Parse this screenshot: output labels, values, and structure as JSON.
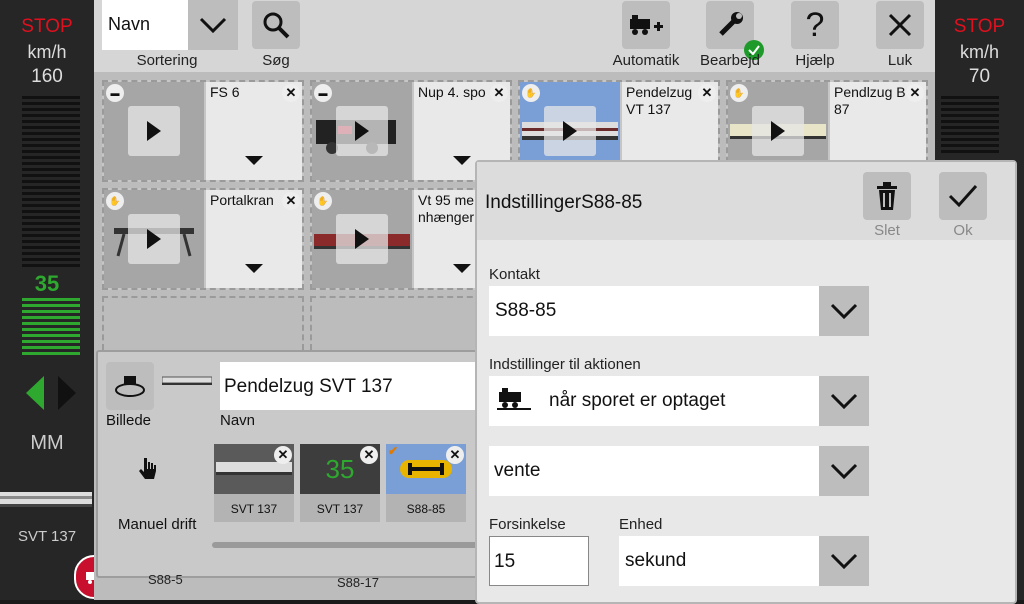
{
  "left_throttle": {
    "stop": "STOP",
    "unit": "km/h",
    "max": "160",
    "speed": "35",
    "mode": "MM",
    "loco_name": "SVT 137"
  },
  "right_throttle": {
    "stop": "STOP",
    "unit": "km/h",
    "max": "70"
  },
  "toolbar": {
    "sort_value": "Navn",
    "sort_label": "Sortering",
    "search_label": "Søg",
    "automatic_label": "Automatik",
    "edit_label": "Bearbejd",
    "help_label": "Hjælp",
    "close_label": "Luk"
  },
  "tiles": [
    {
      "name": "FS 6"
    },
    {
      "name": "Nup 4. spo"
    },
    {
      "name": "Pendelzug\nVT 137"
    },
    {
      "name": "Pendlzug B\n87"
    },
    {
      "name": "Portalkran"
    },
    {
      "name": "Vt 95 me\nnhænger"
    }
  ],
  "editor": {
    "name_value": "Pendelzug SVT 137",
    "name_label": "Navn",
    "image_label": "Billede",
    "manual_label": "Manuel drift",
    "actions": [
      {
        "label": "SVT 137"
      },
      {
        "label": "SVT 137",
        "speed": "35"
      },
      {
        "label": "S88-85"
      }
    ]
  },
  "bottom_labels": {
    "s88_5": "S88-5",
    "s88_17": "S88-17"
  },
  "dialog": {
    "title": "IndstillingerS88-85",
    "delete_label": "Slet",
    "ok_label": "Ok",
    "contact_label": "Kontakt",
    "contact_value": "S88-85",
    "action_label": "Indstillinger til aktionen",
    "action_value": "når sporet er optaget",
    "mode_value": "vente",
    "delay_label": "Forsinkelse",
    "delay_value": "15",
    "unit_label": "Enhed",
    "unit_value": "sekund"
  },
  "colors": {
    "stop_red": "#e0101e",
    "speed_green": "#2ea82e",
    "ok_green": "#1e9a2a",
    "button_grey": "#bdbdbd"
  }
}
